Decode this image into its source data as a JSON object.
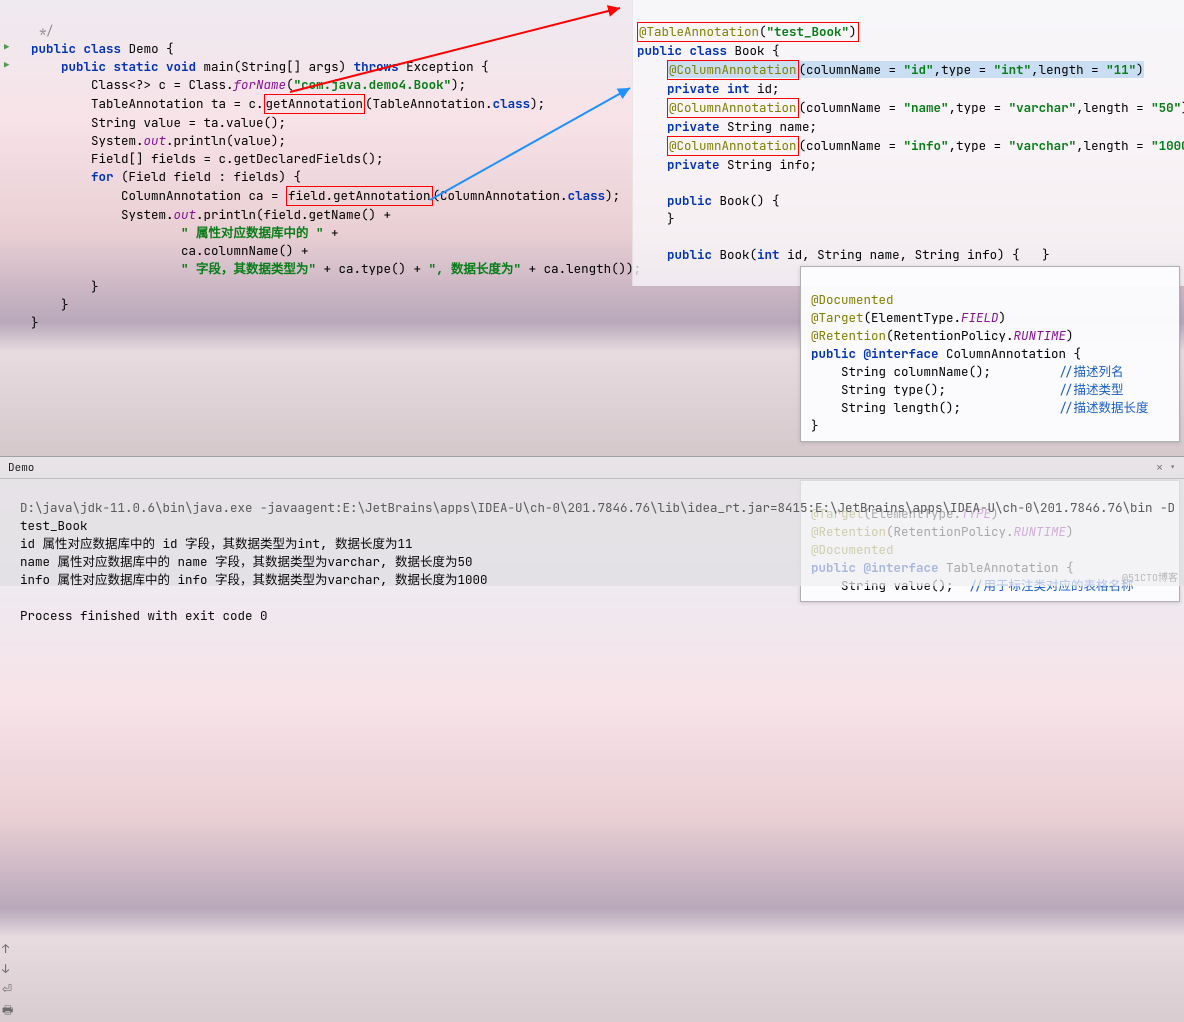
{
  "left_code": {
    "comment_end": "*/",
    "l1a": "public",
    "l1b": "class",
    "l1c": "Demo {",
    "l2a": "public static void",
    "l2b": "main",
    "l2c": "(String[] args)",
    "l2d": "throws",
    "l2e": "Exception {",
    "l3a": "Class<?> c = Class.",
    "l3b": "forName",
    "l3c": "(",
    "l3d": "\"com.java.demo4.Book\"",
    "l3e": ");",
    "l4a": "TableAnnotation ta = c.",
    "l4b": "getAnnotation",
    "l4c": "(TableAnnotation.",
    "l4d": "class",
    "l4e": ");",
    "l5": "String value = ta.value();",
    "l6a": "System.",
    "l6b": "out",
    "l6c": ".println(value);",
    "l7": "Field[] fields = c.getDeclaredFields();",
    "l8a": "for",
    "l8b": " (Field field : fields) {",
    "l9a": "ColumnAnnotation ca = ",
    "l9b": "field.getAnnotation",
    "l9c": "(ColumnAnnotation.",
    "l9d": "class",
    "l9e": ");",
    "l10a": "System.",
    "l10b": "out",
    "l10c": ".println(field.getName() +",
    "l11a": "\" 属性对应数据库中的 \"",
    "l11b": " +",
    "l12": "ca.columnName() +",
    "l13a": "\" 字段，其数据类型为\"",
    "l13b": " + ca.type() + ",
    "l13c": "\", 数据长度为\"",
    "l13d": " + ca.length());",
    "l14": "}",
    "l15": "}",
    "l16": "}"
  },
  "right_code": {
    "r1a": "@TableAnnotation",
    "r1b": "(",
    "r1c": "\"test_Book\"",
    "r1d": ")",
    "r2a": "public class",
    "r2b": " Book {",
    "r3a": "@ColumnAnnotation",
    "r3b": "(columnName = ",
    "r3c": "\"id\"",
    "r3d": ",type = ",
    "r3e": "\"int\"",
    "r3f": ",length = ",
    "r3g": "\"11\"",
    "r3h": ")",
    "r4a": "private int",
    "r4b": " id;",
    "r5a": "@ColumnAnnotation",
    "r5b": "(columnName = ",
    "r5c": "\"name\"",
    "r5d": ",type = ",
    "r5e": "\"varchar\"",
    "r5f": ",length = ",
    "r5g": "\"50\"",
    "r5h": ")",
    "r6a": "private",
    "r6b": " String name;",
    "r7a": "@ColumnAnnotation",
    "r7b": "(columnName = ",
    "r7c": "\"info\"",
    "r7d": ",type = ",
    "r7e": "\"varchar\"",
    "r7f": ",length = ",
    "r7g": "\"1000\"",
    "r7h": ")",
    "r8a": "private",
    "r8b": " String info;",
    "r9a": "public",
    "r9b": " Book() {",
    "r10": "}",
    "r11a": "public",
    "r11b": " Book(",
    "r11c": "int",
    "r11d": " id, String name, String info) {   }"
  },
  "popup1": {
    "p1": "@Documented",
    "p2a": "@Target",
    "p2b": "(ElementType.",
    "p2c": "FIELD",
    "p2d": ")",
    "p3a": "@Retention",
    "p3b": "(RetentionPolicy.",
    "p3c": "RUNTIME",
    "p3d": ")",
    "p4a": "public",
    "p4b": " @interface",
    "p4c": " ColumnAnnotation {",
    "p5a": "String columnName();",
    "p5b": "//描述列名",
    "p6a": "String type();",
    "p6b": "//描述类型",
    "p7a": "String length();",
    "p7b": "//描述数据长度",
    "p8": "}"
  },
  "popup2": {
    "q1a": "@Target",
    "q1b": "(ElementType.",
    "q1c": "TYPE",
    "q1d": ")",
    "q2a": "@Retention",
    "q2b": "(RetentionPolicy.",
    "q2c": "RUNTIME",
    "q2d": ")",
    "q3": "@Documented",
    "q4a": "public",
    "q4b": " @interface",
    "q4c": " TableAnnotation {",
    "q5a": "String value();",
    "q5b": "//用于标注类对应的表格名称"
  },
  "console": {
    "tab": "Demo",
    "cmd": "D:\\java\\jdk-11.0.6\\bin\\java.exe -javaagent:E:\\JetBrains\\apps\\IDEA-U\\ch-0\\201.7846.76\\lib\\idea_rt.jar=8415:E:\\JetBrains\\apps\\IDEA-U\\ch-0\\201.7846.76\\bin -D",
    "o1": "test_Book",
    "o2": "id 属性对应数据库中的 id 字段，其数据类型为int, 数据长度为11",
    "o3": "name 属性对应数据库中的 name 字段，其数据类型为varchar, 数据长度为50",
    "o4": "info 属性对应数据库中的 info 字段，其数据类型为varchar, 数据长度为1000",
    "o5": "Process finished with exit code 0"
  },
  "watermark": "@51CTO博客"
}
